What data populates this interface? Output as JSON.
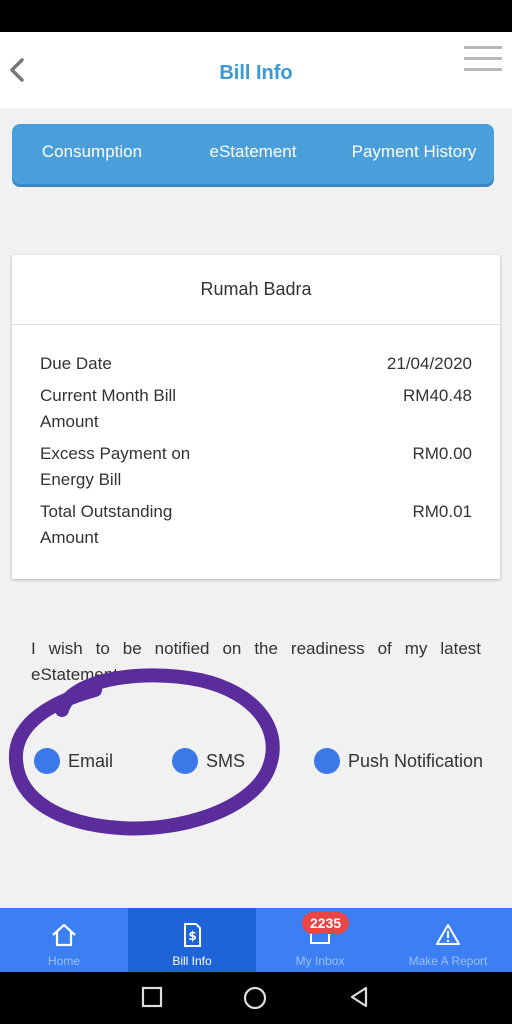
{
  "header": {
    "title": "Bill Info"
  },
  "tabs": [
    {
      "label": "Consumption"
    },
    {
      "label": "eStatement"
    },
    {
      "label": "Payment History"
    }
  ],
  "bill_card": {
    "title": "Rumah Badra",
    "rows": [
      {
        "label": "Due Date",
        "value": "21/04/2020"
      },
      {
        "label": "Current Month Bill Amount",
        "value": "RM40.48"
      },
      {
        "label": "Excess Payment on Energy Bill",
        "value": "RM0.00"
      },
      {
        "label": "Total Outstanding Amount",
        "value": "RM0.01"
      }
    ]
  },
  "notify": {
    "text": "I wish to be notified on the readiness of my latest eStatement",
    "options": [
      {
        "label": "Email"
      },
      {
        "label": "SMS"
      },
      {
        "label": "Push Notification"
      }
    ]
  },
  "bottom_nav": {
    "items": [
      {
        "label": "Home",
        "icon": "home-icon"
      },
      {
        "label": "Bill Info",
        "icon": "bill-icon"
      },
      {
        "label": "My Inbox",
        "icon": "inbox-icon",
        "badge": "2235"
      },
      {
        "label": "Make A Report",
        "icon": "warning-icon"
      }
    ]
  },
  "colors": {
    "accent": "#4a9fdb",
    "nav": "#3b7ff3",
    "nav_active": "#1f63d8",
    "option_dot": "#3b78e8",
    "badge": "#e84545",
    "scribble": "#5b2d9c"
  }
}
